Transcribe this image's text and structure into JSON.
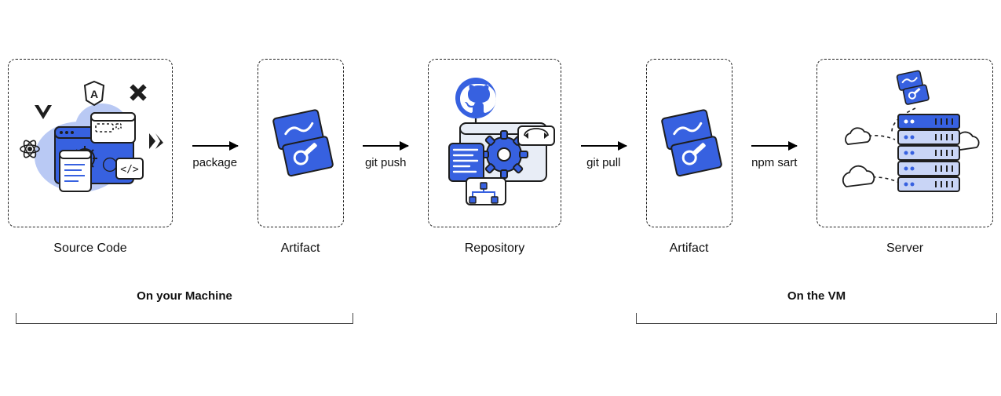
{
  "nodes": {
    "source": {
      "label": "Source Code"
    },
    "artifact1": {
      "label": "Artifact"
    },
    "repo": {
      "label": "Repository"
    },
    "artifact2": {
      "label": "Artifact"
    },
    "server": {
      "label": "Server"
    }
  },
  "arrows": {
    "package": {
      "label": "package"
    },
    "push": {
      "label": "git push"
    },
    "pull": {
      "label": "git pull"
    },
    "start": {
      "label": "npm sart"
    }
  },
  "groups": {
    "local": {
      "label": "On your Machine"
    },
    "vm": {
      "label": "On the VM"
    }
  }
}
